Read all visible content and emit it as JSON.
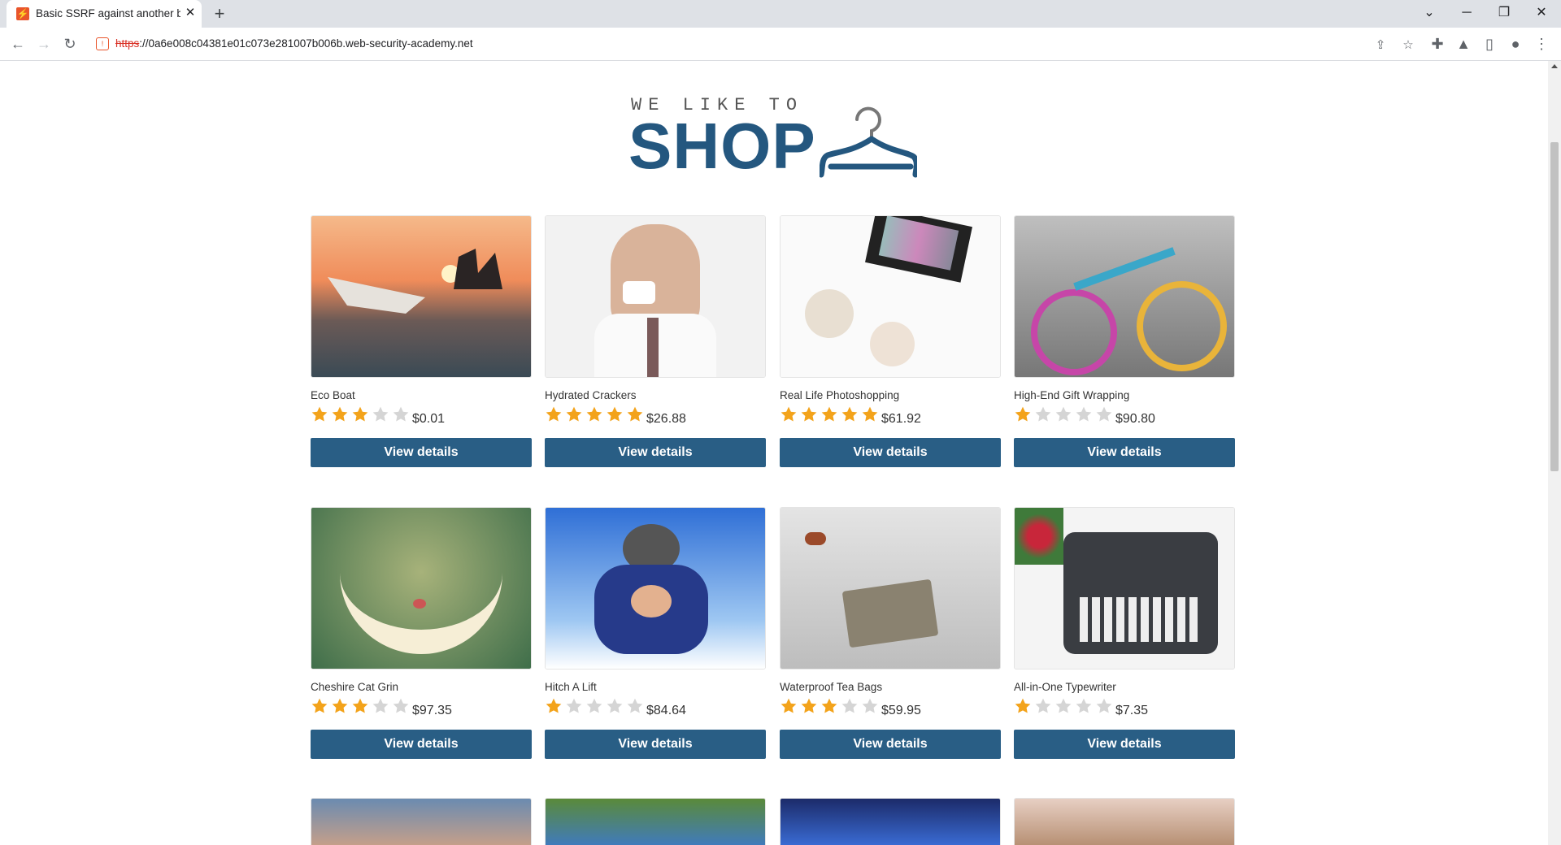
{
  "browser": {
    "tab_title": "Basic SSRF against another back-end system",
    "tab_close": "✕",
    "new_tab": "+",
    "url_scheme": "https",
    "url_rest": "://0a6e008c04381e01c073e281007b006b.web-security-academy.net"
  },
  "logo": {
    "tagline": "WE LIKE TO",
    "wordmark": "SHOP"
  },
  "colors": {
    "brand": "#24577f",
    "button": "#295e85",
    "star_filled": "#f3a31b",
    "star_empty": "#d5d5d5"
  },
  "products": [
    {
      "name": "Eco Boat",
      "stars": 3,
      "price": "$0.01",
      "button": "View details",
      "image": "paper-boat-at-sunset"
    },
    {
      "name": "Hydrated Crackers",
      "stars": 5,
      "price": "$26.88",
      "button": "View details",
      "image": "man-eating-cracker"
    },
    {
      "name": "Real Life Photoshopping",
      "stars": 5,
      "price": "$61.92",
      "button": "View details",
      "image": "makeup-brushes"
    },
    {
      "name": "High-End Gift Wrapping",
      "stars": 1,
      "price": "$90.80",
      "button": "View details",
      "image": "yarn-wrapped-bicycle"
    },
    {
      "name": "Cheshire Cat Grin",
      "stars": 3,
      "price": "$97.35",
      "button": "View details",
      "image": "floating-grin"
    },
    {
      "name": "Hitch A Lift",
      "stars": 1,
      "price": "$84.64",
      "button": "View details",
      "image": "tandem-skydivers"
    },
    {
      "name": "Waterproof Tea Bags",
      "stars": 3,
      "price": "$59.95",
      "button": "View details",
      "image": "tea-bag"
    },
    {
      "name": "All-in-One Typewriter",
      "stars": 1,
      "price": "$7.35",
      "button": "View details",
      "image": "typewriter"
    }
  ]
}
